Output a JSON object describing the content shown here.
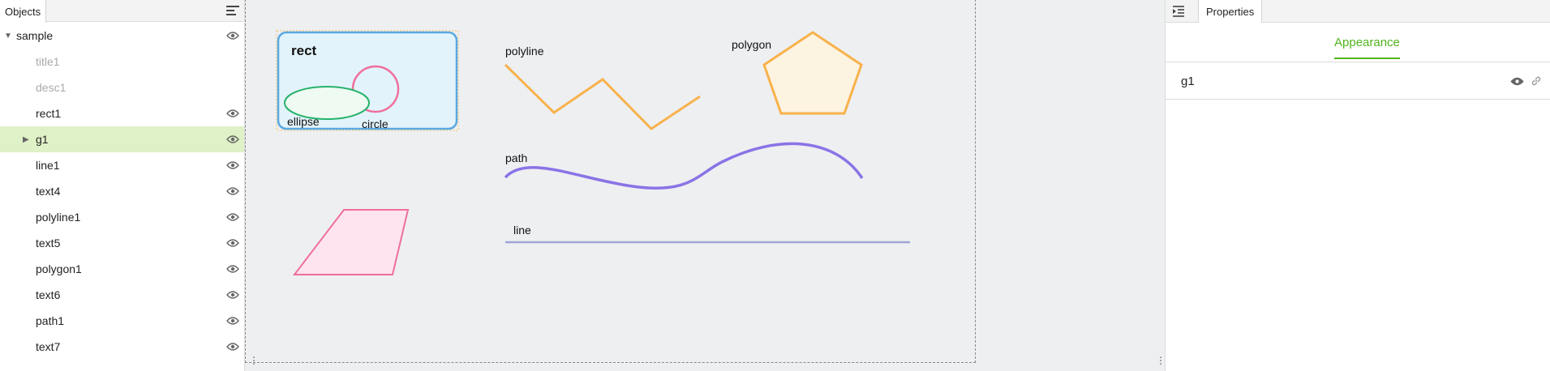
{
  "objects_panel": {
    "tab_label": "Objects",
    "items": [
      {
        "label": "sample",
        "visible": true
      },
      {
        "label": "title1",
        "visible": false
      },
      {
        "label": "desc1",
        "visible": false
      },
      {
        "label": "rect1",
        "visible": true
      },
      {
        "label": "g1",
        "visible": true
      },
      {
        "label": "line1",
        "visible": true
      },
      {
        "label": "text4",
        "visible": true
      },
      {
        "label": "polyline1",
        "visible": true
      },
      {
        "label": "text5",
        "visible": true
      },
      {
        "label": "polygon1",
        "visible": true
      },
      {
        "label": "text6",
        "visible": true
      },
      {
        "label": "path1",
        "visible": true
      },
      {
        "label": "text7",
        "visible": true
      }
    ]
  },
  "canvas": {
    "labels": {
      "rect": "rect",
      "ellipse": "ellipse",
      "circle": "circle",
      "polyline": "polyline",
      "polygon": "polygon",
      "path": "path",
      "line": "line"
    },
    "colors": {
      "rect_stroke": "#5aa9df",
      "rect_fill": "#e3f3fb",
      "ellipse_stroke": "#27b36b",
      "ellipse_fill": "#eefaf2",
      "circle_stroke": "#ef6f9b",
      "polyline_stroke": "#f8b24b",
      "polygon_stroke": "#f8b24b",
      "polygon_fill": "#fdf3e1",
      "path_stroke": "#8a73e6",
      "line_stroke": "#a0a4d6",
      "parallelogram_stroke": "#ef6f9b",
      "parallelogram_fill": "#fde4ef"
    }
  },
  "properties_panel": {
    "tab_label": "Properties",
    "subtab_label": "Appearance",
    "selected_object": "g1",
    "accent_color": "#52b41d"
  }
}
